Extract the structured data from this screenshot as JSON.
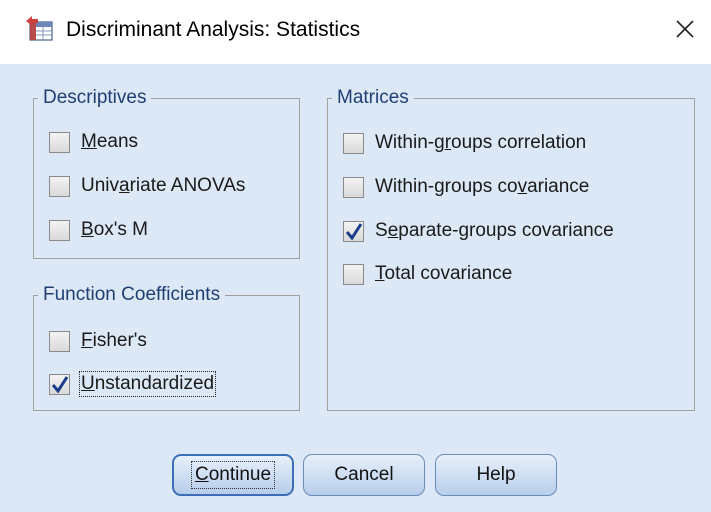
{
  "window": {
    "title": "Discriminant Analysis: Statistics"
  },
  "icons": {
    "app": "spss-table-icon",
    "close": "close-icon"
  },
  "descriptives": {
    "legend": "Descriptives",
    "items": [
      {
        "pre": "",
        "mn": "M",
        "post": "eans",
        "checked": false
      },
      {
        "pre": "Univ",
        "mn": "a",
        "post": "riate ANOVAs",
        "checked": false
      },
      {
        "pre": "",
        "mn": "B",
        "post": "ox's M",
        "checked": false
      }
    ]
  },
  "function_coefficients": {
    "legend": "Function Coefficients",
    "items": [
      {
        "pre": "",
        "mn": "F",
        "post": "isher's",
        "checked": false
      },
      {
        "pre": "",
        "mn": "U",
        "post": "nstandardized",
        "checked": true
      }
    ]
  },
  "matrices": {
    "legend": "Matrices",
    "items": [
      {
        "pre": "Within-g",
        "mn": "r",
        "post": "oups correlation",
        "checked": false
      },
      {
        "pre": "Within-groups co",
        "mn": "v",
        "post": "ariance",
        "checked": false
      },
      {
        "pre": "S",
        "mn": "e",
        "post": "parate-groups covariance",
        "checked": true
      },
      {
        "pre": "",
        "mn": "T",
        "post": "otal covariance",
        "checked": false
      }
    ]
  },
  "buttons": {
    "continue": {
      "pre": "",
      "mn": "C",
      "post": "ontinue"
    },
    "cancel": "Cancel",
    "help": "Help"
  },
  "colors": {
    "client_bg": "#dce8f5",
    "legend_text": "#1f3f73",
    "check_mark": "#1c3c8c",
    "button_border_default": "#3b6fb6"
  }
}
